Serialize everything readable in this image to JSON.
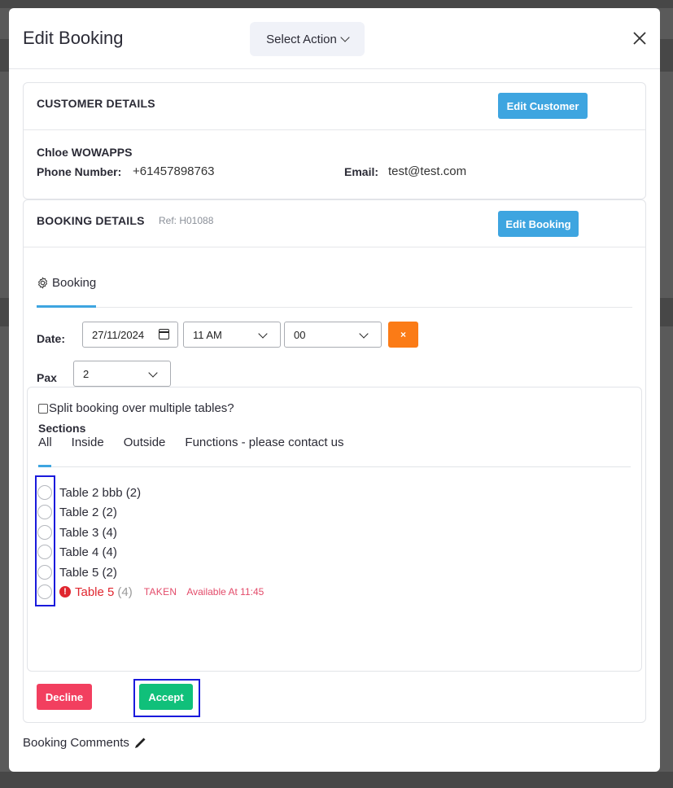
{
  "modal": {
    "title": "Edit Booking",
    "select_action": "Select Action"
  },
  "customer": {
    "heading": "CUSTOMER DETAILS",
    "edit_button": "Edit Customer",
    "name": "Chloe WOWAPPS",
    "phone_label": "Phone Number:",
    "phone_value": "+61457898763",
    "email_label": "Email:",
    "email_value": "test@test.com"
  },
  "booking": {
    "heading": "BOOKING DETAILS",
    "ref": "Ref: H01088",
    "edit_button": "Edit Booking",
    "tab_label": "Booking",
    "date_label": "Date:",
    "date_value": "27/11/2024",
    "hour_value": "11 AM",
    "minute_value": "00",
    "clear_button": "×",
    "pax_label": "Pax",
    "pax_value": "2"
  },
  "tables": {
    "split_label": "Split booking over multiple tables?",
    "sections_label": "Sections",
    "sections": [
      "All",
      "Inside",
      "Outside",
      "Functions - please contact us"
    ],
    "active_section": "All",
    "rows": [
      {
        "name": "Table 2 bbb",
        "pax": "(2)"
      },
      {
        "name": "Table 2",
        "pax": "(2)"
      },
      {
        "name": "Table 3",
        "pax": "(4)"
      },
      {
        "name": "Table 4",
        "pax": "(4)"
      },
      {
        "name": "Table 5",
        "pax": "(2)"
      }
    ],
    "taken_row": {
      "name": "Table 5",
      "pax": "(4)",
      "status": "TAKEN",
      "available": "Available At 11:45"
    }
  },
  "actions": {
    "decline": "Decline",
    "accept": "Accept"
  },
  "comments_label": "Booking Comments",
  "colors": {
    "primary": "#3ea5e0",
    "danger": "#f23f5f",
    "success": "#10c07a",
    "warning": "#fb7b16",
    "taken": "#e0262f"
  }
}
